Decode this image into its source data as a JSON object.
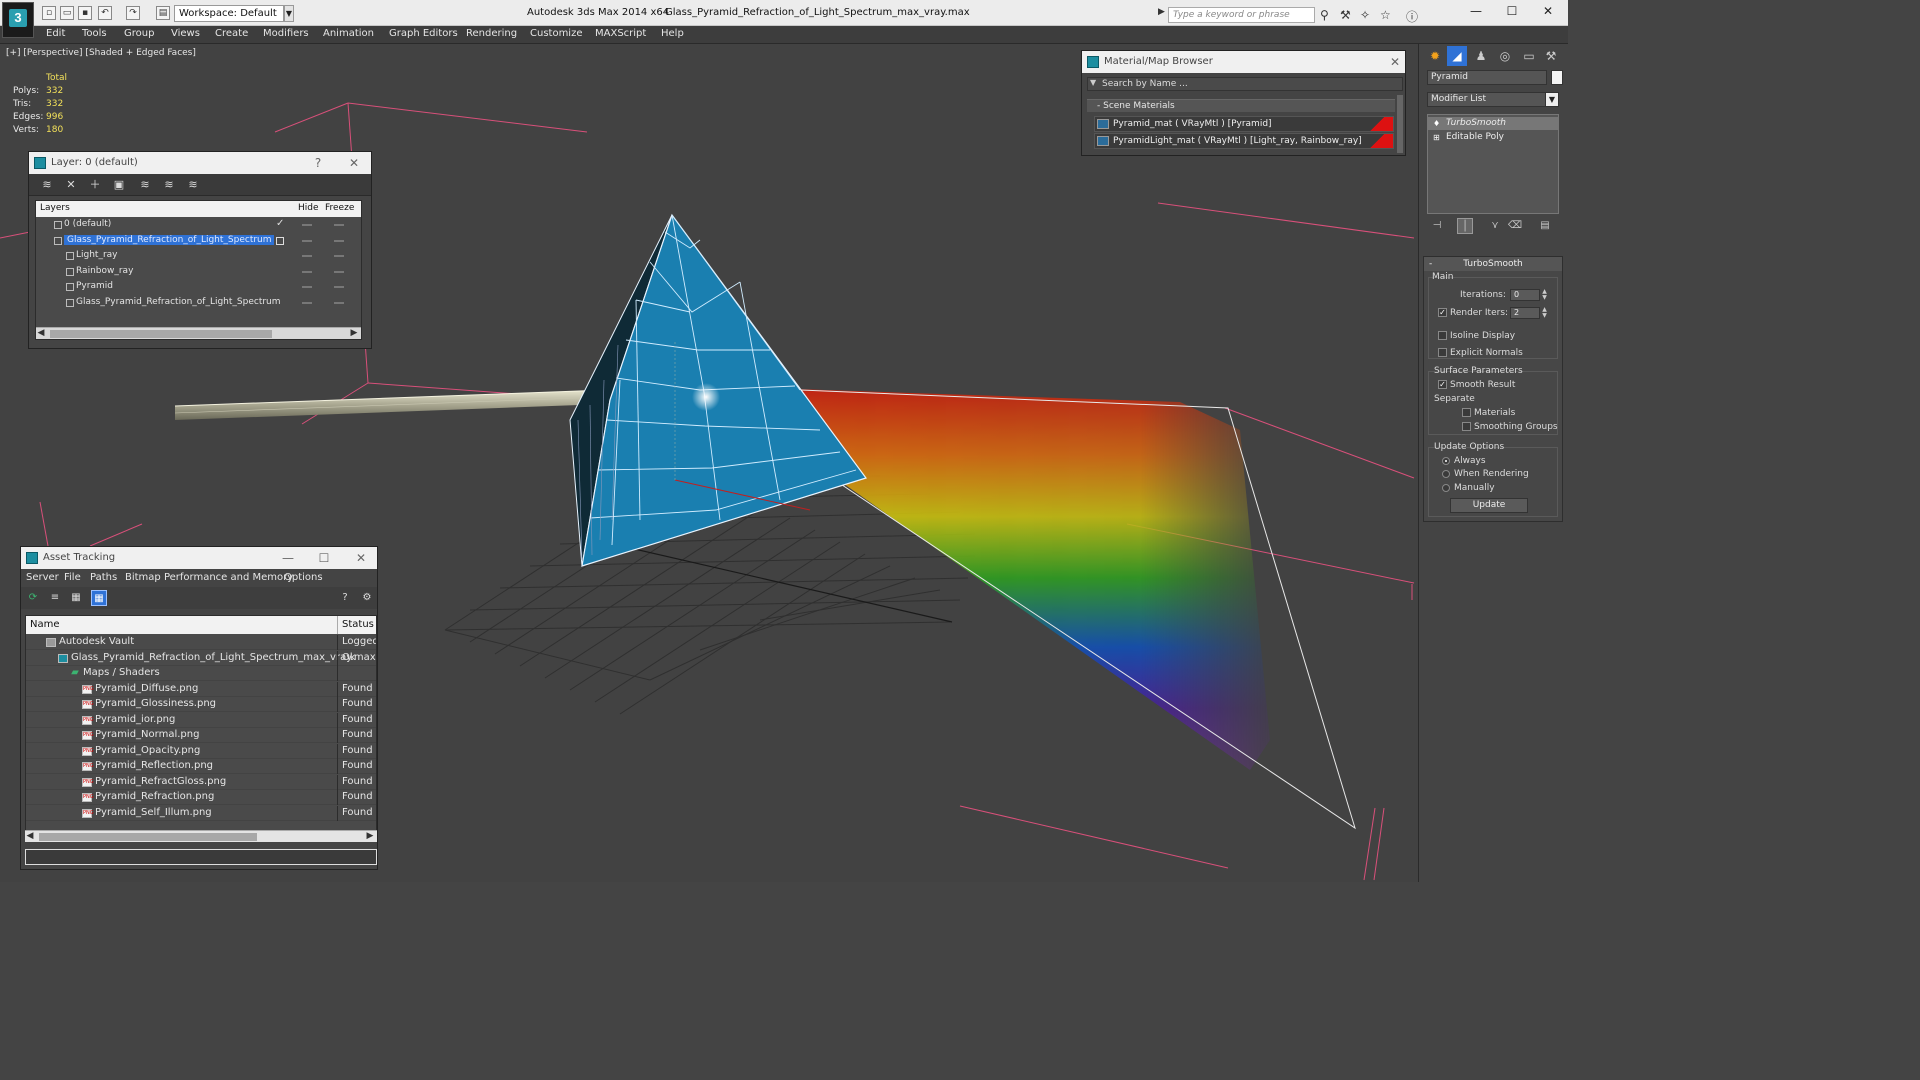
{
  "app": {
    "title": "Autodesk 3ds Max  2014 x64",
    "file": "Glass_Pyramid_Refraction_of_Light_Spectrum_max_vray.max",
    "workspace": "Workspace: Default",
    "search_placeholder": "Type a keyword or phrase",
    "logo": "3"
  },
  "menu": [
    "Edit",
    "Tools",
    "Group",
    "Views",
    "Create",
    "Modifiers",
    "Animation",
    "Graph Editors",
    "Rendering",
    "Customize",
    "MAXScript",
    "Help"
  ],
  "viewport": {
    "label": "[+] [Perspective] [Shaded + Edged Faces]",
    "stats": {
      "header": "Total",
      "rows": [
        {
          "label": "Polys:",
          "value": "332"
        },
        {
          "label": "Tris:",
          "value": "332"
        },
        {
          "label": "Edges:",
          "value": "996"
        },
        {
          "label": "Verts:",
          "value": "180"
        }
      ]
    }
  },
  "layer_window": {
    "title": "Layer: 0 (default)",
    "help": "?",
    "close": "✕",
    "columns": {
      "layers": "Layers",
      "hide": "Hide",
      "freeze": "Freeze"
    },
    "rows": [
      {
        "name": "0 (default)",
        "indent": 0,
        "check": "✓"
      },
      {
        "name": "Glass_Pyramid_Refraction_of_Light_Spectrum",
        "indent": 0,
        "selected": true
      },
      {
        "name": "Light_ray",
        "indent": 1
      },
      {
        "name": "Rainbow_ray",
        "indent": 1
      },
      {
        "name": "Pyramid",
        "indent": 1
      },
      {
        "name": "Glass_Pyramid_Refraction_of_Light_Spectrum",
        "indent": 1
      }
    ]
  },
  "material_browser": {
    "title": "Material/Map Browser",
    "close": "✕",
    "search_placeholder": "Search by Name ...",
    "section": "- Scene Materials",
    "materials": [
      "Pyramid_mat  ( VRayMtl ) [Pyramid]",
      "PyramidLight_mat  ( VRayMtl ) [Light_ray, Rainbow_ray]"
    ]
  },
  "asset_tracking": {
    "title": "Asset Tracking",
    "minimize": "—",
    "maximize": "☐",
    "close": "✕",
    "menu": [
      "Server",
      "File",
      "Paths",
      "Bitmap Performance and Memory",
      "Options"
    ],
    "columns": {
      "name": "Name",
      "status": "Status"
    },
    "rows": [
      {
        "name": "Autodesk Vault",
        "status": "Logged",
        "indent": 1,
        "kind": "vault"
      },
      {
        "name": "Glass_Pyramid_Refraction_of_Light_Spectrum_max_vray.max",
        "status": "Ok",
        "indent": 2,
        "kind": "max"
      },
      {
        "name": "Maps / Shaders",
        "status": "",
        "indent": 3,
        "kind": "folder"
      },
      {
        "name": "Pyramid_Diffuse.png",
        "status": "Found",
        "indent": 4,
        "kind": "png"
      },
      {
        "name": "Pyramid_Glossiness.png",
        "status": "Found",
        "indent": 4,
        "kind": "png"
      },
      {
        "name": "Pyramid_ior.png",
        "status": "Found",
        "indent": 4,
        "kind": "png"
      },
      {
        "name": "Pyramid_Normal.png",
        "status": "Found",
        "indent": 4,
        "kind": "png"
      },
      {
        "name": "Pyramid_Opacity.png",
        "status": "Found",
        "indent": 4,
        "kind": "png"
      },
      {
        "name": "Pyramid_Reflection.png",
        "status": "Found",
        "indent": 4,
        "kind": "png"
      },
      {
        "name": "Pyramid_RefractGloss.png",
        "status": "Found",
        "indent": 4,
        "kind": "png"
      },
      {
        "name": "Pyramid_Refraction.png",
        "status": "Found",
        "indent": 4,
        "kind": "png"
      },
      {
        "name": "Pyramid_Self_Illum.png",
        "status": "Found",
        "indent": 4,
        "kind": "png"
      }
    ]
  },
  "command_panel": {
    "object_name": "Pyramid",
    "modifier_list": "Modifier List",
    "stack": [
      "TurboSmooth",
      "Editable Poly"
    ],
    "rollout": {
      "title": "TurboSmooth",
      "main": "Main",
      "iterations_label": "Iterations:",
      "iterations": "0",
      "render_iters_label": "Render Iters:",
      "render_iters": "2",
      "render_iters_checked": true,
      "isoline": "Isoline Display",
      "explicit_normals": "Explicit Normals",
      "surface_params": "Surface Parameters",
      "smooth_result": "Smooth Result",
      "separate": "Separate",
      "materials": "Materials",
      "smoothing_groups": "Smoothing Groups",
      "update_options": "Update Options",
      "always": "Always",
      "when_rendering": "When Rendering",
      "manually": "Manually",
      "update_button": "Update"
    }
  },
  "colors": {
    "accent": "#2f72d6",
    "stats_value": "#f2e05a",
    "pyramid": "#1a7fb0",
    "bounding_line": "#d8507a"
  }
}
